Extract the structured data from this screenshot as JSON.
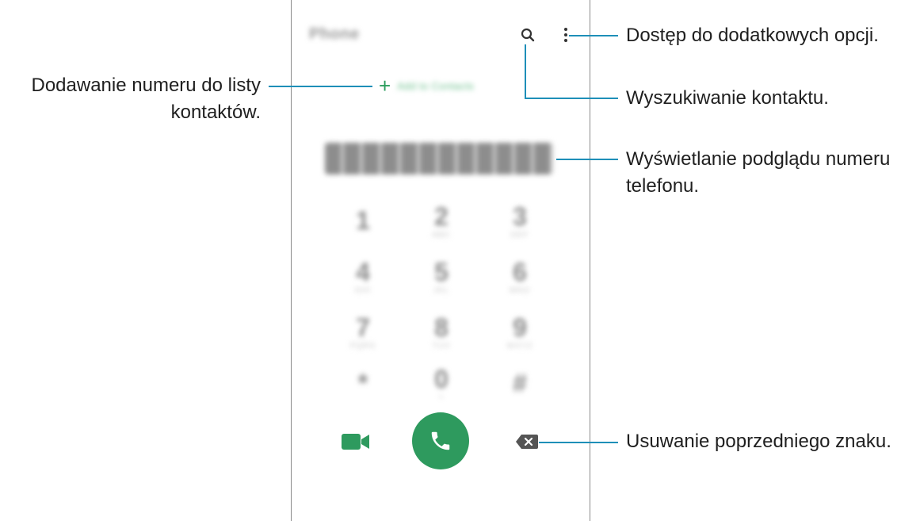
{
  "phone": {
    "app_title": "Phone",
    "add_contact_label": "Add to Contacts",
    "keypad": [
      {
        "digit": "1",
        "sub": ""
      },
      {
        "digit": "2",
        "sub": "ABC"
      },
      {
        "digit": "3",
        "sub": "DEF"
      },
      {
        "digit": "4",
        "sub": "GHI"
      },
      {
        "digit": "5",
        "sub": "JKL"
      },
      {
        "digit": "6",
        "sub": "MNO"
      },
      {
        "digit": "7",
        "sub": "PQRS"
      },
      {
        "digit": "8",
        "sub": "TUV"
      },
      {
        "digit": "9",
        "sub": "WXYZ"
      },
      {
        "digit": "*",
        "sub": ""
      },
      {
        "digit": "0",
        "sub": "+"
      },
      {
        "digit": "#",
        "sub": ""
      }
    ],
    "colors": {
      "accent_green": "#2e9a5e",
      "callout_blue": "#1e8fb8"
    },
    "icons": {
      "search": "search-icon",
      "more": "more-options-icon",
      "video": "video-call-icon",
      "call": "phone-call-icon",
      "backspace": "backspace-icon"
    }
  },
  "callouts": {
    "more_options": "Dostęp do dodatkowych opcji.",
    "add_contact_line1": "Dodawanie numeru do listy",
    "add_contact_line2": "kontaktów.",
    "search": "Wyszukiwanie kontaktu.",
    "number_preview_line1": "Wyświetlanie podglądu numeru",
    "number_preview_line2": "telefonu.",
    "delete_char": "Usuwanie poprzedniego znaku."
  }
}
